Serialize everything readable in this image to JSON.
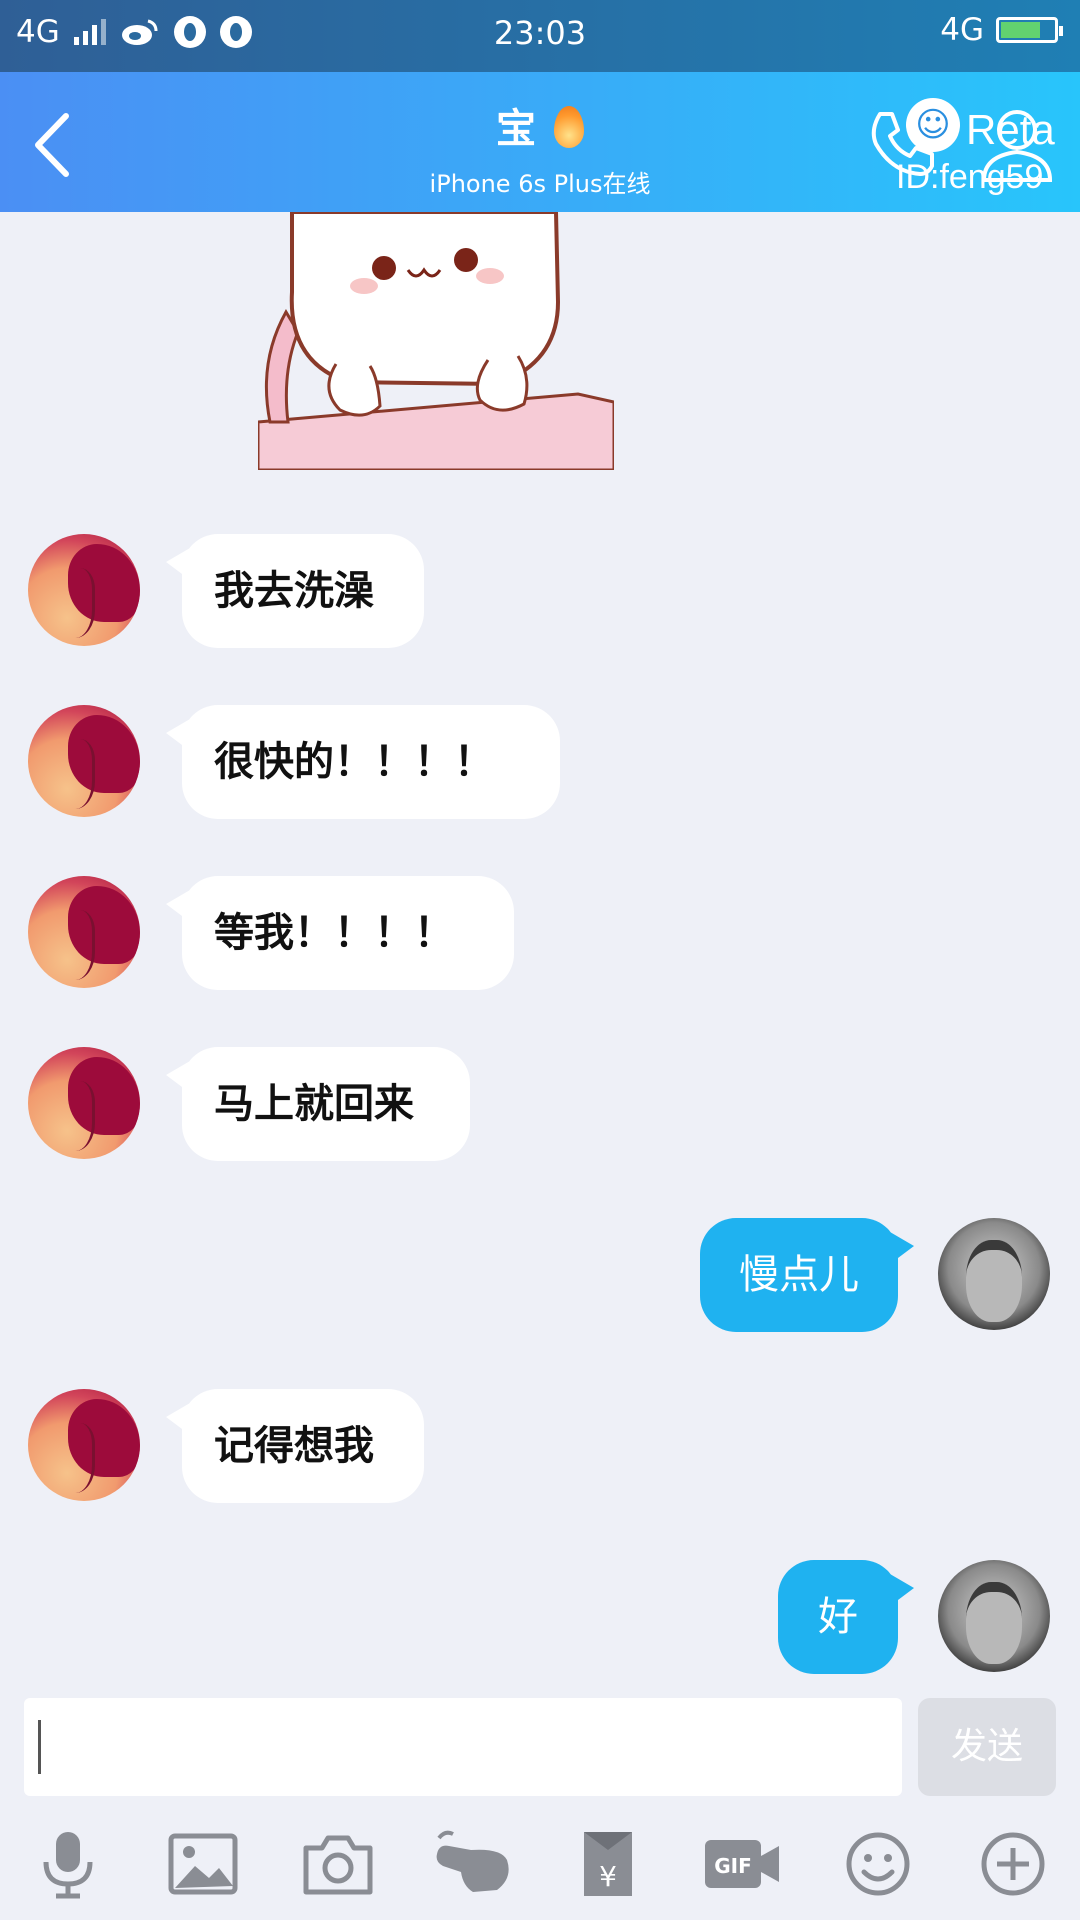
{
  "status_bar": {
    "network_left": "4G",
    "time": "23:03",
    "network_right": "4G"
  },
  "header": {
    "title": "宝",
    "subtitle": "iPhone 6s Plus在线"
  },
  "watermark": {
    "brand": "Reta",
    "id": "ID:feng59"
  },
  "messages": [
    {
      "side": "in",
      "text": "我去洗澡"
    },
    {
      "side": "in",
      "text": "很快的！！！！"
    },
    {
      "side": "in",
      "text": "等我！！！！"
    },
    {
      "side": "in",
      "text": "马上就回来"
    },
    {
      "side": "out",
      "text": "慢点儿"
    },
    {
      "side": "in",
      "text": "记得想我"
    },
    {
      "side": "out",
      "text": "好"
    }
  ],
  "composer": {
    "input_value": "",
    "send_label": "发送"
  },
  "toolbar": {
    "icons": [
      "microphone-icon",
      "image-icon",
      "camera-icon",
      "poke-hand-icon",
      "red-packet-icon",
      "gif-icon",
      "emoji-icon",
      "plus-icon"
    ],
    "gif_label": "GIF"
  },
  "colors": {
    "header_start": "#4b8ff4",
    "header_end": "#28c5fb",
    "outgoing_bubble": "#1fb2f0",
    "incoming_bubble": "#ffffff",
    "background": "#eef0f7"
  }
}
